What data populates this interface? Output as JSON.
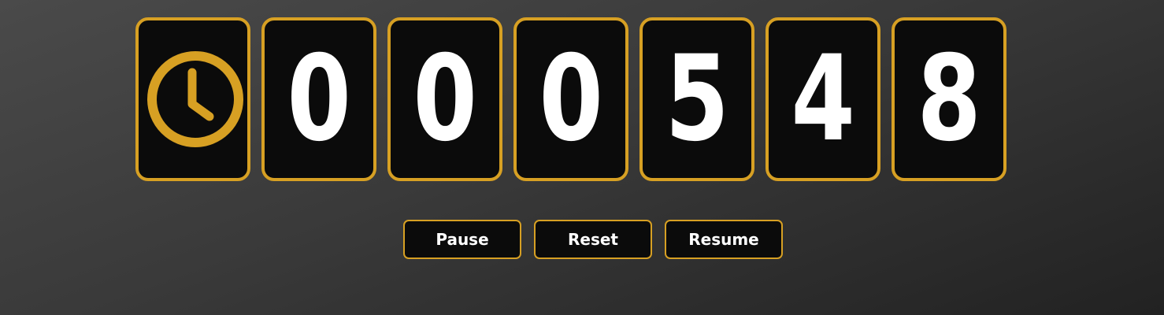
{
  "colors": {
    "accent": "#d7a023",
    "tile_background": "#0b0b0b",
    "digit": "#ffffff"
  },
  "timer": {
    "icon": "clock-icon",
    "digits": [
      "0",
      "0",
      "0",
      "5",
      "4",
      "8"
    ]
  },
  "controls": {
    "pause_label": "Pause",
    "reset_label": "Reset",
    "resume_label": "Resume"
  }
}
